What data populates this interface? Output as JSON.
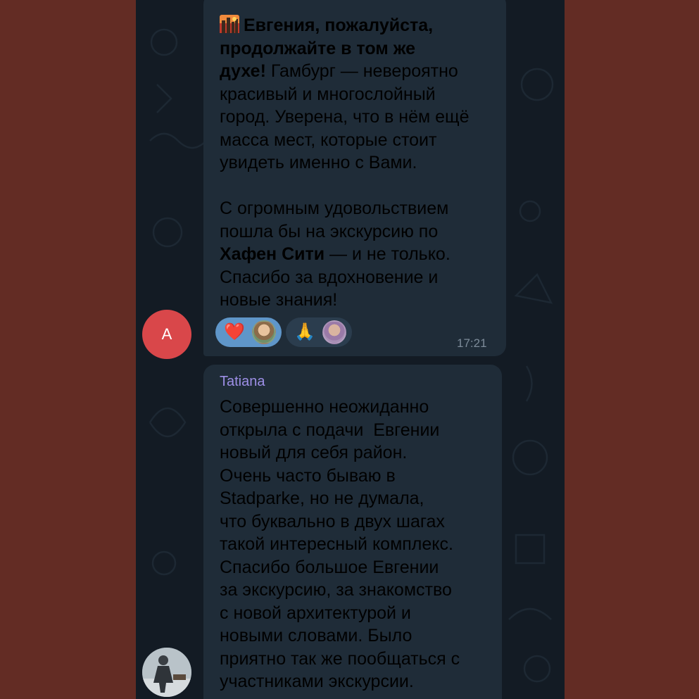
{
  "colors": {
    "page_background": "#632c24",
    "chat_background": "#131b24",
    "bubble": "#1f2c38",
    "author_name": "#9d8fe6",
    "avatar_a": "#d9474a",
    "reaction_active": "#5f96c9"
  },
  "messages": [
    {
      "icon": "city-sunset-emoji",
      "line1_bold": "Евгения, пожалуйста,",
      "line2_bold": "продолжайте в том же",
      "line3_bold": "духе!",
      "line3_rest": " Гамбург — невероятно",
      "line4": "красивый и многослойный",
      "line5": "город. Уверена, что в нём ещё",
      "line6": "масса мест, которые стоит",
      "line7": "увидеть именно с Вами.",
      "line8": "С огромным удовольствием",
      "line9": "пошла бы на экскурсию по",
      "line10_bold": "Хафен Сити",
      "line10_rest": " — и не только.",
      "line11": "Спасибо за вдохновение и",
      "line12": "новые знания!",
      "time": "17:21",
      "avatar_letter": "A",
      "reactions": [
        {
          "emoji": "❤️",
          "icon": "heart-emoji"
        },
        {
          "emoji": "🙏",
          "icon": "folded-hands-emoji"
        }
      ]
    },
    {
      "author": "Tatiana",
      "lines": [
        "Совершенно неожиданно",
        "открыла с подачи  Евгении",
        "новый для себя район.",
        "Очень часто бываю в",
        "Stadparke, но не думала,",
        "что буквально в двух шагах",
        "такой интересный комплекс.",
        "Спасибо большое Евгении",
        "за экскурсию, за знакомство",
        "с новой архитектурой и",
        "новыми словами. Было",
        "приятно так же пообщаться с",
        "участниками экскурсии."
      ]
    }
  ]
}
